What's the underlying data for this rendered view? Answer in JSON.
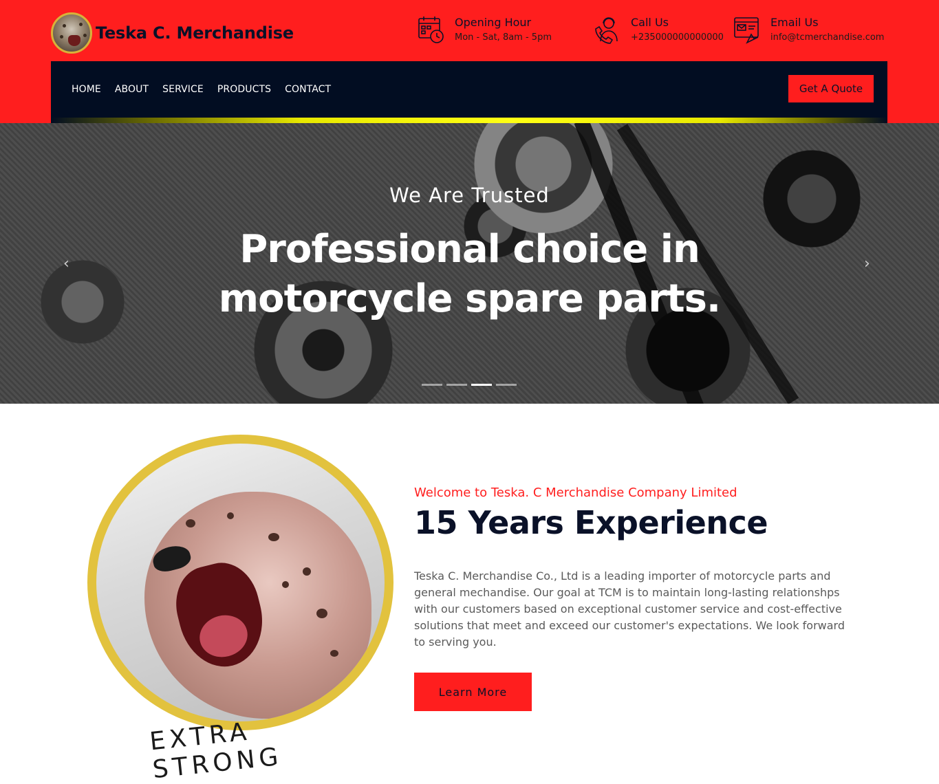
{
  "brand": {
    "name": "Teska C. Merchandise"
  },
  "header_info": [
    {
      "title": "Opening Hour",
      "sub": "Mon - Sat, 8am - 5pm",
      "icon": "calendar-clock-icon"
    },
    {
      "title": "Call Us",
      "sub": "+235000000000000",
      "icon": "call-agent-icon"
    },
    {
      "title": "Email Us",
      "sub": "info@tcmerchandise.com",
      "icon": "email-browser-icon"
    }
  ],
  "nav": {
    "links": [
      "HOME",
      "ABOUT",
      "SERVICE",
      "PRODUCTS",
      "CONTACT"
    ],
    "quote_label": "Get A Quote"
  },
  "hero": {
    "subtitle": "We Are Trusted",
    "title_line1": "Professional choice in",
    "title_line2": "motorcycle spare parts.",
    "prev_icon": "‹",
    "next_icon": "›",
    "slide_count": 4,
    "active_slide": 3
  },
  "about": {
    "tagline": "Welcome to Teska. C Merchandise Company Limited",
    "title": "15 Years Experience",
    "text": "Teska C. Merchandise Co., Ltd is a leading importer of motorcycle parts and general mechandise. Our goal at TCM is to maintain long-lasting relationshps with our customers based on exceptional customer service and cost-effective solutions that meet and exceed our customer's expectations. We look forward to serving you.",
    "button_label": "Learn More",
    "image_caption": "EXTRA STRONG"
  },
  "colors": {
    "brand_red": "#ff1e1e",
    "navy": "#020d22",
    "accent_yellow": "#ffff14",
    "ring_gold": "#e2c23e"
  }
}
